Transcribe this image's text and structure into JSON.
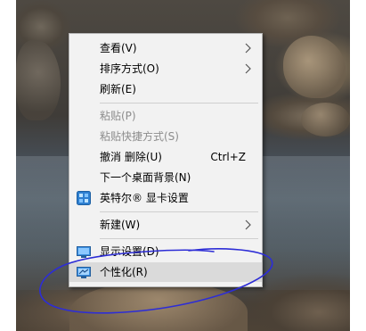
{
  "menu": {
    "items": [
      {
        "label": "查看(V)"
      },
      {
        "label": "排序方式(O)"
      },
      {
        "label": "刷新(E)"
      },
      {
        "label": "粘贴(P)"
      },
      {
        "label": "粘贴快捷方式(S)"
      },
      {
        "label": "撤消 删除(U)",
        "shortcut": "Ctrl+Z"
      },
      {
        "label": "下一个桌面背景(N)"
      },
      {
        "label": "英特尔® 显卡设置"
      },
      {
        "label": "新建(W)"
      },
      {
        "label": "显示设置(D)"
      },
      {
        "label": "个性化(R)"
      }
    ]
  },
  "colors": {
    "annotation_stroke": "#2d2dd6",
    "menu_background": "#f2f2f2",
    "hover_background": "#dadada",
    "disabled_text": "#8d8d8d"
  },
  "icons": {
    "submenu": "chevron-right-icon",
    "intel": "intel-graphics-icon",
    "display": "display-settings-icon",
    "personalize": "personalize-icon"
  }
}
